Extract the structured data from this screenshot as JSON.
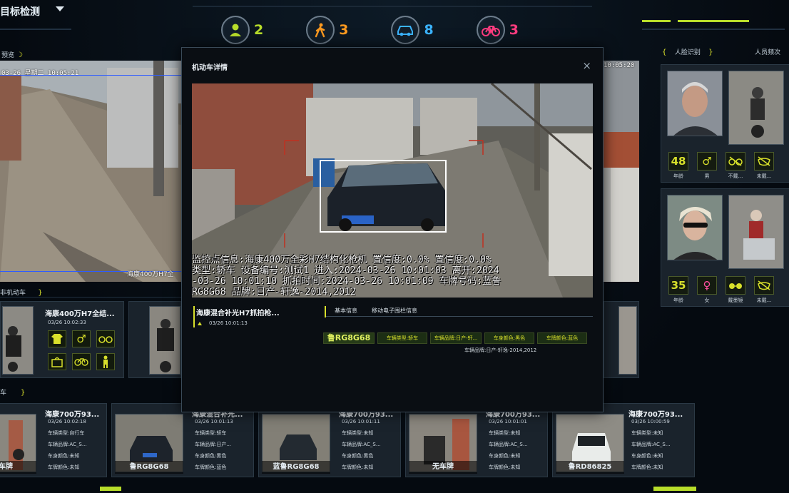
{
  "header": {
    "title": "目标检测",
    "stats": [
      {
        "icon": "person-icon",
        "count": "2",
        "color": "#b8dd2a"
      },
      {
        "icon": "pedestrian-icon",
        "count": "3",
        "color": "#ff9a1f"
      },
      {
        "icon": "car-icon",
        "count": "8",
        "color": "#3bb4ff"
      },
      {
        "icon": "bicycle-icon",
        "count": "3",
        "color": "#ff3c7f"
      }
    ]
  },
  "left_panel": {
    "label": "预览",
    "timestamp": "03-26 星期二 10:05:21",
    "watermark": "海康400万H7全"
  },
  "right_panel": {
    "label_left": "人脸识别",
    "label_right": "人员频次",
    "timestamp": "10:05:20",
    "faces": [
      {
        "age": "48",
        "age_label": "年龄",
        "gender_label": "男",
        "attrs": [
          "不戴...",
          "未戴..."
        ]
      },
      {
        "age": "35",
        "age_label": "年龄",
        "gender_label": "女",
        "attrs": [
          "戴墨镜",
          "未戴..."
        ]
      }
    ]
  },
  "nonmotor_section": {
    "label": "非机动车",
    "card": {
      "title": "海康400万H7全结...",
      "time": "03/26 10:02:33"
    }
  },
  "vehicle_section": {
    "label": "车",
    "cards": [
      {
        "title": "海康700万93...",
        "time": "03/26 10:02:18",
        "plate": "无车牌",
        "lines": [
          "车辆类型:自行车",
          "车辆品牌:AC_S...",
          "车身颜色:未知",
          "车牌颜色:未知"
        ]
      },
      {
        "title": "海康混合补光...",
        "time": "03/26 10:01:13",
        "plate": "鲁RG8G68",
        "lines": [
          "车辆类型:轿车",
          "车辆品牌:日产...",
          "车身颜色:黑色",
          "车牌颜色:蓝色"
        ]
      },
      {
        "title": "海康700万93...",
        "time": "03/26 10:01:11",
        "plate": "蓝鲁RG8G68",
        "lines": [
          "车辆类型:未知",
          "车辆品牌:AC_S...",
          "车身颜色:黑色",
          "车牌颜色:未知"
        ]
      },
      {
        "title": "海康700万93...",
        "time": "03/26 10:01:01",
        "plate": "无车牌",
        "lines": [
          "车辆类型:未知",
          "车辆品牌:AC_S...",
          "车身颜色:未知",
          "车牌颜色:未知"
        ]
      },
      {
        "title": "海康700万93...",
        "time": "03/26 10:00:59",
        "plate": "鲁RD86825",
        "lines": [
          "车辆类型:未知",
          "车辆品牌:AC_S...",
          "车身颜色:未知",
          "车牌颜色:未知"
        ]
      }
    ]
  },
  "modal": {
    "title": "机动车详情",
    "close_glyph": "×",
    "osd_lines": [
      "监控点信息:海康400万全彩H7结构化枪机 置信度:0.0% 置信度:0.0%",
      " 类型:轿车 设备编号:测试1 进入:2024-03-26 10:01:03 离开:2024",
      "-03-26 10:01:10 抓拍时间:2024-03-26 10:01:09   车牌号码:蓝鲁",
      "RG8G68 品牌:日产-轩逸-2014,2012"
    ],
    "sub_title": "海康混合补光H7抓拍枪...",
    "sub_time": "03/26 10:01:13",
    "tabs": [
      "基本信息",
      "移动电子围栏信息"
    ],
    "tags": [
      "鲁RG8G68",
      "车辆类型:轿车",
      "车辆品牌:日产-轩...",
      "车身颜色:黑色",
      "车牌颜色:蓝色"
    ],
    "brand_line": "车辆品牌:日产-轩逸-2014,2012"
  }
}
